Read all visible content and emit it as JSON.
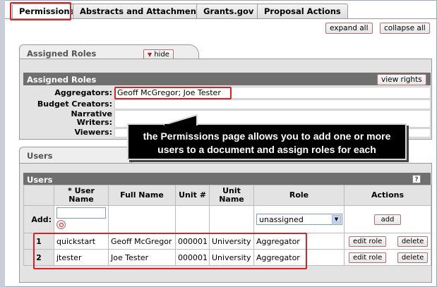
{
  "tabs": [
    {
      "label": "Permissions"
    },
    {
      "label": "Abstracts and Attachments"
    },
    {
      "label": "Grants.gov"
    },
    {
      "label": "Proposal Actions"
    }
  ],
  "toolbar": {
    "expand_all": "expand all",
    "collapse_all": "collapse all"
  },
  "assigned_roles_panel": {
    "tab_title": "Assigned Roles",
    "hide_label": "hide",
    "section_title": "Assigned Roles",
    "view_rights_label": "view rights",
    "roles": [
      {
        "label": "Aggregators:",
        "value": "Geoff McGregor; Joe Tester"
      },
      {
        "label": "Budget Creators:",
        "value": ""
      },
      {
        "label": "Narrative Writers:",
        "value": ""
      },
      {
        "label": "Viewers:",
        "value": ""
      }
    ]
  },
  "callout": {
    "line1": "the Permissions page allows you to add one or more",
    "line2": "users to a document and assign roles for each"
  },
  "users_panel": {
    "tab_title": "Users",
    "section_title": "Users",
    "help_icon": "?",
    "columns": {
      "user_name": "* User Name",
      "full_name": "Full Name",
      "unit_num": "Unit #",
      "unit_name": "Unit Name",
      "role": "Role",
      "actions": "Actions"
    },
    "add_row": {
      "label": "Add:",
      "user_name_value": "",
      "role_selected": "unassigned",
      "add_button": "add"
    },
    "rows": [
      {
        "num": "1",
        "user_name": "quickstart",
        "full_name": "Geoff McGregor",
        "unit_num": "000001",
        "unit_name": "University",
        "role": "Aggregator",
        "edit": "edit role",
        "delete": "delete"
      },
      {
        "num": "2",
        "user_name": "jtester",
        "full_name": "Joe Tester",
        "unit_num": "000001",
        "unit_name": "University",
        "role": "Aggregator",
        "edit": "edit role",
        "delete": "delete"
      }
    ]
  },
  "colors": {
    "highlight": "#d8232a",
    "section_header": "#6f6f6f",
    "panel_bg": "#e3e3e3"
  }
}
